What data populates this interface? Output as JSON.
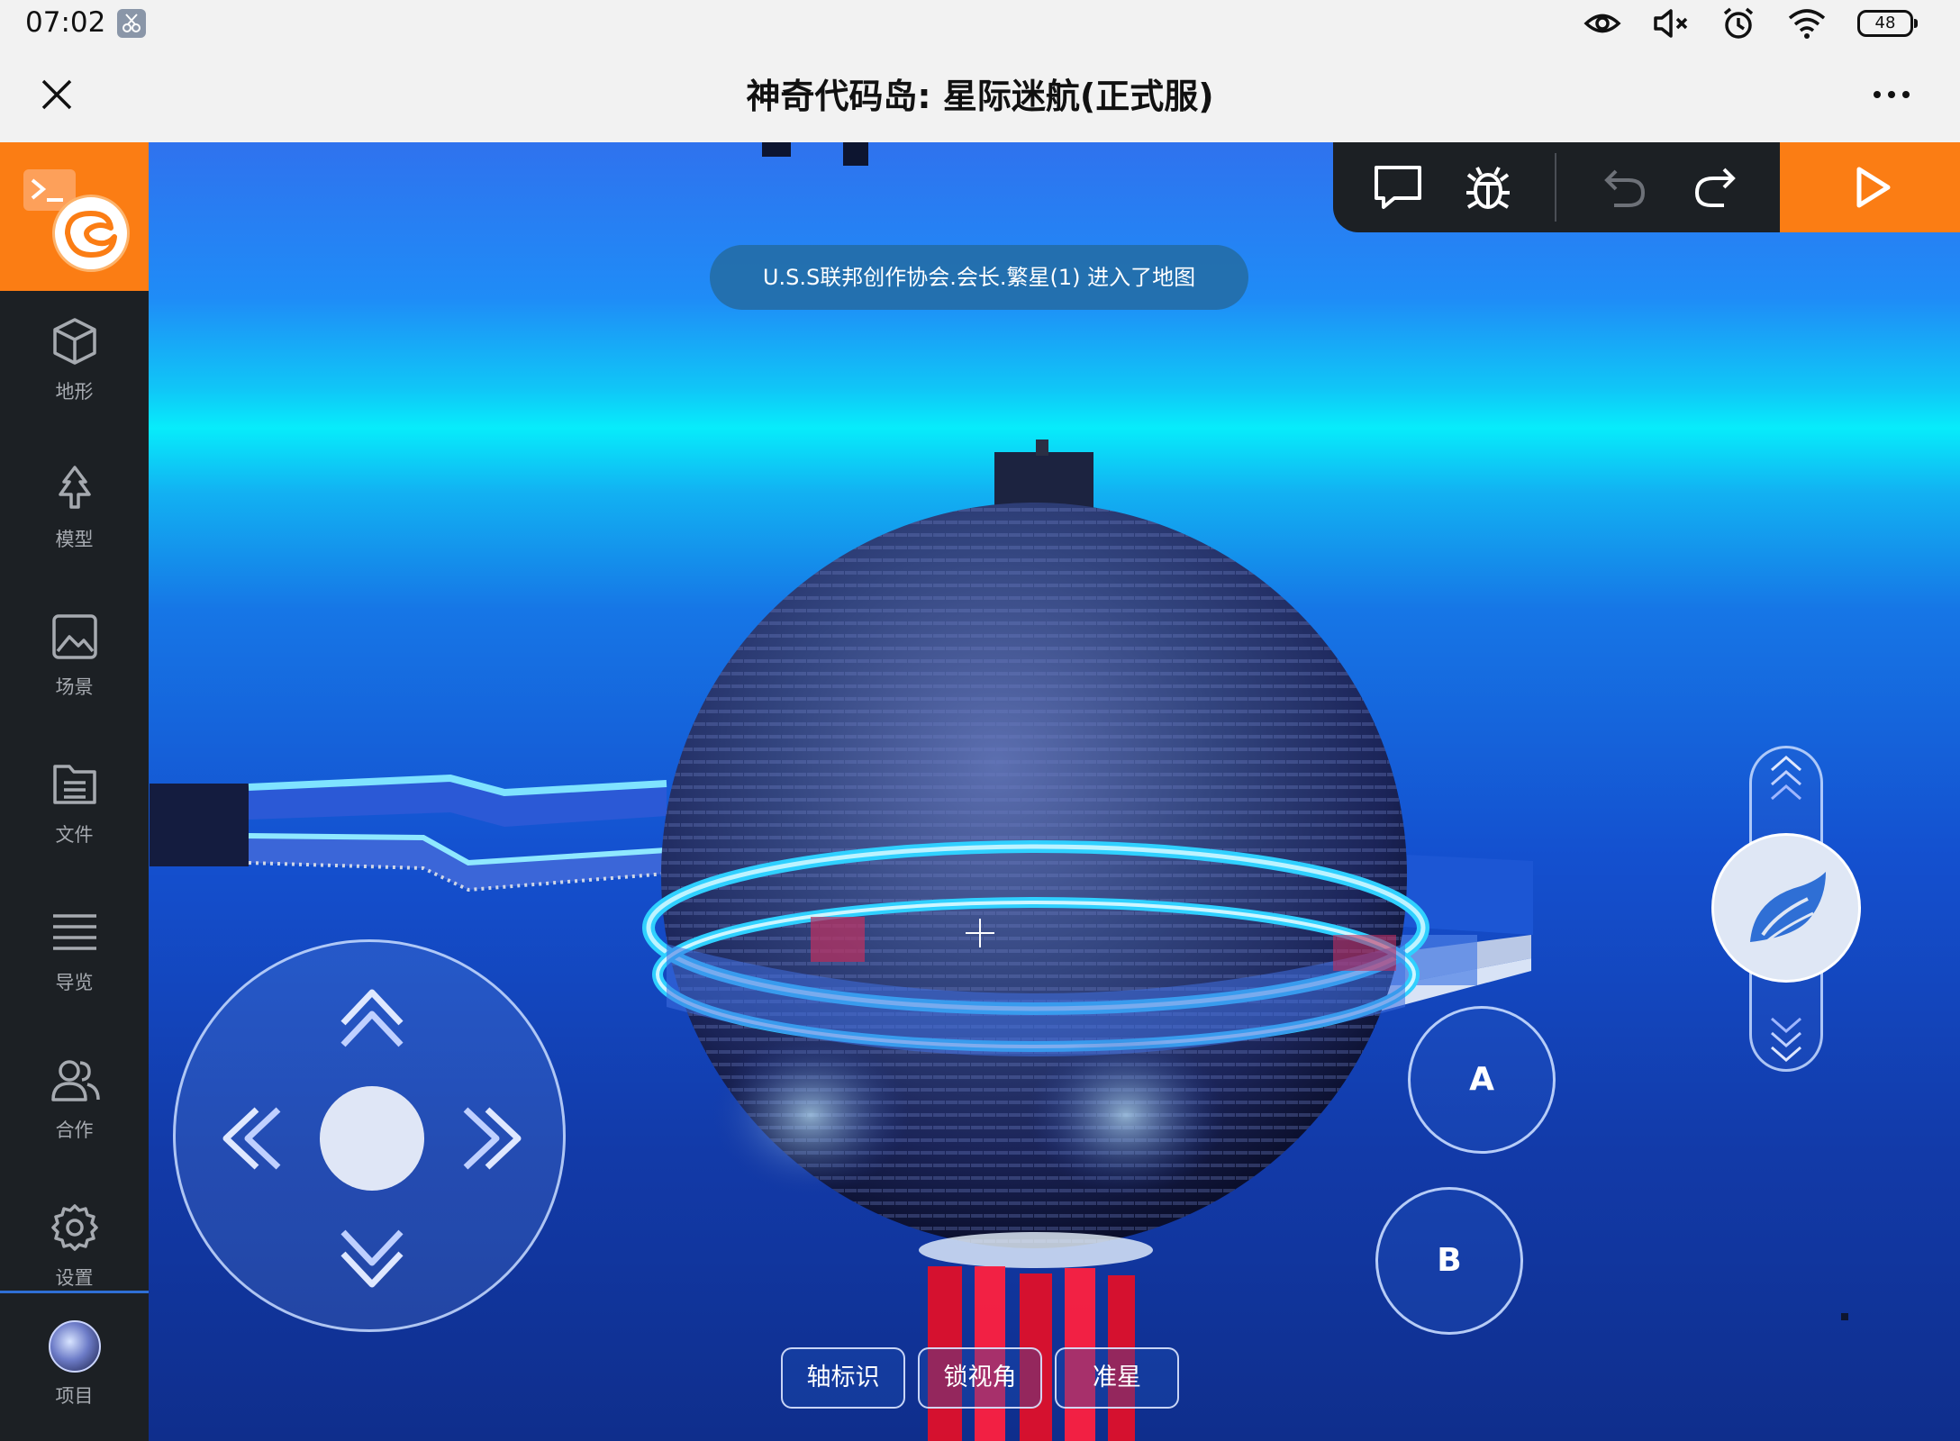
{
  "status_bar": {
    "time": "07:02",
    "battery": "48",
    "icons": [
      "screenshot-icon",
      "eye-icon",
      "mute-icon",
      "alarm-icon",
      "wifi-icon",
      "battery-icon"
    ]
  },
  "title_bar": {
    "title": "神奇代码岛: 星际迷航(正式服)",
    "close_icon": "close-icon",
    "more_icon": "more-icon"
  },
  "sidebar": {
    "items": [
      {
        "label": "地形",
        "icon": "cube-icon"
      },
      {
        "label": "模型",
        "icon": "tree-icon"
      },
      {
        "label": "场景",
        "icon": "image-icon"
      },
      {
        "label": "文件",
        "icon": "file-icon"
      },
      {
        "label": "导览",
        "icon": "list-icon"
      },
      {
        "label": "合作",
        "icon": "users-icon"
      },
      {
        "label": "设置",
        "icon": "gear-icon"
      },
      {
        "label": "项目",
        "icon": "project-icon"
      }
    ]
  },
  "toolbar": {
    "icons": [
      "comment-icon",
      "bug-icon",
      "undo-icon",
      "redo-icon",
      "play-icon"
    ]
  },
  "notification": {
    "text": "U.S.S联邦创作协会.会长.繁星(1) 进入了地图"
  },
  "controls": {
    "button_a": "A",
    "button_b": "B",
    "chips": [
      "轴标识",
      "锁视角",
      "准星"
    ]
  },
  "colors": {
    "accent_orange": "#fb7d14",
    "sidebar_dark": "#1c2024",
    "sky_cyan": "#07ecfb",
    "ocean_blue": "#1450cf"
  }
}
